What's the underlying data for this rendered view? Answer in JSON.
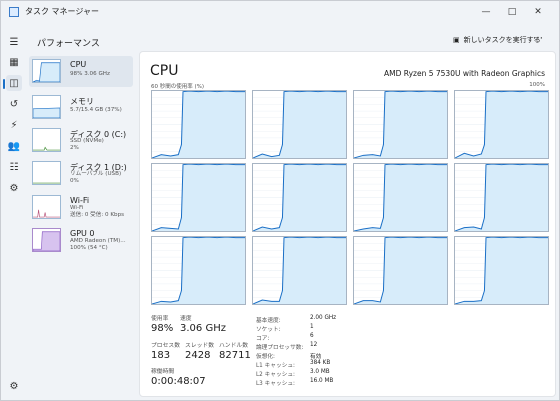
{
  "app": {
    "title": "タスク マネージャー",
    "section": "パフォーマンス",
    "run_task": "新しいタスクを実行する",
    "more": "⋯"
  },
  "window_controls": {
    "minimize": "—",
    "maximize": "□",
    "close": "✕"
  },
  "sidebar": {
    "items": [
      {
        "name": "CPU",
        "sub1": "98% 3.06 GHz",
        "sub2": "",
        "selected": true
      },
      {
        "name": "メモリ",
        "sub1": "5.7/15.4 GB (37%)",
        "sub2": ""
      },
      {
        "name": "ディスク 0 (C:)",
        "sub1": "SSD (NVMe)",
        "sub2": "2%"
      },
      {
        "name": "ディスク 1 (D:)",
        "sub1": "リムーバブル (USB)",
        "sub2": "0%"
      },
      {
        "name": "Wi-Fi",
        "sub1": "Wi-Fi",
        "sub2": "送信: 0 受信: 0 Kbps"
      },
      {
        "name": "GPU 0",
        "sub1": "AMD Radeon (TM)...",
        "sub2": "100% (54 °C)"
      }
    ]
  },
  "main": {
    "title": "CPU",
    "model": "AMD Ryzen 5 7530U with Radeon Graphics",
    "graph_left": "60 秒間の使用率 (%)",
    "graph_right": "100%",
    "stats": {
      "usage_label": "使用率",
      "usage_value": "98%",
      "speed_label": "速度",
      "speed_value": "3.06 GHz",
      "processes_label": "プロセス数",
      "processes_value": "183",
      "threads_label": "スレッド数",
      "threads_value": "2428",
      "handles_label": "ハンドル数",
      "handles_value": "82711",
      "uptime_label": "稼働時間",
      "uptime_value": "0:00:48:07"
    },
    "specs": [
      {
        "label": "基本速度:",
        "value": "2.00 GHz"
      },
      {
        "label": "ソケット:",
        "value": "1"
      },
      {
        "label": "コア:",
        "value": "6"
      },
      {
        "label": "論理プロセッサ数:",
        "value": "12"
      },
      {
        "label": "仮想化:",
        "value": "有効"
      },
      {
        "label": "L1 キャッシュ:",
        "value": "384 KB"
      },
      {
        "label": "L2 キャッシュ:",
        "value": "3.0 MB"
      },
      {
        "label": "L3 キャッシュ:",
        "value": "16.0 MB"
      }
    ]
  },
  "colors": {
    "cpu_line": "#1a6fc6",
    "cpu_fill": "#d7ecfa",
    "gpu_fill": "#d7c3ef",
    "wifi_line": "#b8527a"
  },
  "chart_data": {
    "type": "area",
    "title": "CPU",
    "xlabel": "60 秒間の使用率 (%)",
    "ylabel": "",
    "ylim": [
      0,
      100
    ],
    "x": [
      60,
      54,
      48,
      43,
      41,
      40,
      36,
      30,
      24,
      18,
      12,
      6,
      0
    ],
    "series": [
      {
        "values": [
          0,
          5,
          3,
          5,
          20,
          99,
          100,
          99,
          100,
          99,
          100,
          99,
          99
        ]
      },
      {
        "values": [
          0,
          6,
          2,
          4,
          20,
          99,
          100,
          99,
          100,
          99,
          100,
          99,
          99
        ]
      },
      {
        "values": [
          0,
          4,
          5,
          3,
          20,
          99,
          100,
          99,
          100,
          99,
          100,
          99,
          99
        ]
      },
      {
        "values": [
          0,
          7,
          3,
          6,
          20,
          99,
          100,
          99,
          100,
          99,
          100,
          99,
          99
        ]
      },
      {
        "values": [
          0,
          5,
          4,
          3,
          20,
          99,
          100,
          99,
          100,
          99,
          100,
          99,
          99
        ]
      },
      {
        "values": [
          0,
          6,
          3,
          5,
          20,
          99,
          100,
          99,
          100,
          99,
          100,
          99,
          99
        ]
      },
      {
        "values": [
          0,
          3,
          5,
          4,
          20,
          99,
          100,
          99,
          100,
          99,
          100,
          99,
          99
        ]
      },
      {
        "values": [
          0,
          5,
          6,
          3,
          20,
          99,
          100,
          99,
          100,
          99,
          100,
          99,
          99
        ]
      },
      {
        "values": [
          0,
          4,
          3,
          5,
          20,
          99,
          100,
          99,
          100,
          99,
          100,
          99,
          99
        ]
      },
      {
        "values": [
          0,
          6,
          4,
          4,
          20,
          99,
          100,
          99,
          100,
          99,
          100,
          99,
          99
        ]
      },
      {
        "values": [
          0,
          5,
          5,
          3,
          20,
          99,
          100,
          99,
          100,
          99,
          100,
          99,
          99
        ]
      },
      {
        "values": [
          0,
          4,
          4,
          5,
          20,
          99,
          100,
          99,
          100,
          99,
          100,
          99,
          99
        ]
      }
    ]
  }
}
